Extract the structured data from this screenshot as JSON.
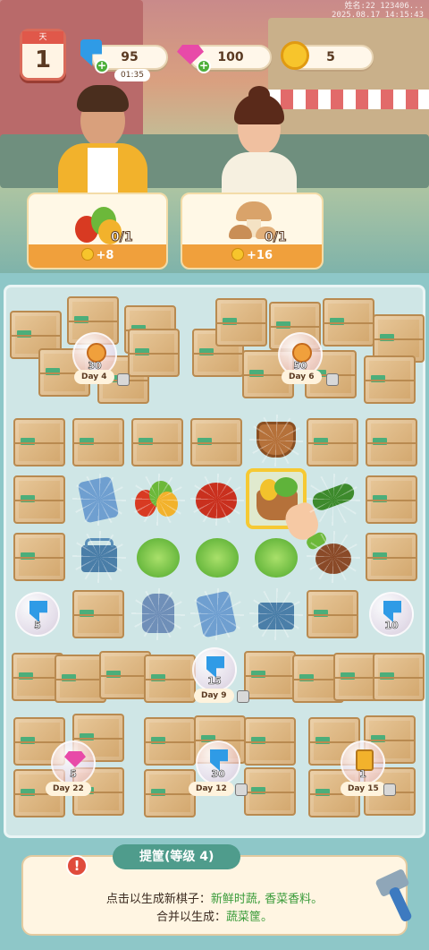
{
  "status_time": {
    "line1": "姓名:22 123406...",
    "line2": "2025.08.17 14:15:43"
  },
  "day": {
    "label": "天",
    "value": "1"
  },
  "energy": {
    "value": "95",
    "timer": "01:35"
  },
  "gems": {
    "value": "100"
  },
  "coins": {
    "value": "5"
  },
  "orders": [
    {
      "count": "0/1",
      "reward": "+8"
    },
    {
      "count": "0/1",
      "reward": "+16"
    }
  ],
  "locked_areas": [
    {
      "bubble": "30",
      "day": "Day 4"
    },
    {
      "bubble": "50",
      "day": "Day 6"
    },
    {
      "bubble": "15",
      "day": "Day 9"
    },
    {
      "bubble": "5",
      "day": "Day 22"
    },
    {
      "bubble": "30",
      "day": "Day 12"
    },
    {
      "bubble": "1",
      "day": "Day 15"
    }
  ],
  "board_bubbles": [
    {
      "value": "5"
    },
    {
      "value": "10"
    }
  ],
  "tip": {
    "title": "提筐(等级 4)",
    "line1_prefix": "点击以生成新棋子：",
    "line1_items": "新鲜时蔬, 香菜香料。",
    "line2_prefix": "合并以生成：",
    "line2_items": "蔬菜筐。"
  },
  "colors": {
    "accent": "#4f9c8c",
    "reward": "#f0a03c",
    "selected": "#f6c933"
  }
}
